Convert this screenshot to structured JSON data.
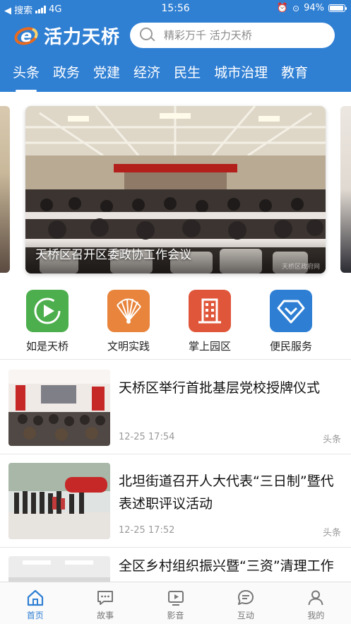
{
  "status_bar": {
    "back_label": "◀ 搜索",
    "network": "4G",
    "time": "15:56",
    "battery": "94%"
  },
  "header": {
    "app_name": "活力天桥",
    "search_placeholder": "精彩万千 活力天桥",
    "accent_color": "#2f7fd3"
  },
  "tabs": [
    {
      "label": "头条",
      "active": true
    },
    {
      "label": "政务"
    },
    {
      "label": "党建"
    },
    {
      "label": "经济"
    },
    {
      "label": "民生"
    },
    {
      "label": "城市治理"
    },
    {
      "label": "教育"
    }
  ],
  "carousel": {
    "caption": "天桥区召开区委政协工作会议",
    "watermark": "天桥区政府网"
  },
  "quick_entries": [
    {
      "label": "如是天桥",
      "color": "#4cae4c",
      "icon": "play-icon"
    },
    {
      "label": "文明实践",
      "color": "#e8843c",
      "icon": "fan-icon"
    },
    {
      "label": "掌上园区",
      "color": "#e0563a",
      "icon": "building-icon"
    },
    {
      "label": "便民服务",
      "color": "#2e7fd4",
      "icon": "diamond-icon"
    }
  ],
  "news": [
    {
      "title": "天桥区举行首批基层党校授牌仪式",
      "time": "12-25 17:54",
      "tag": "头条"
    },
    {
      "title": "北坦街道召开人大代表“三日制”暨代表述职评议活动",
      "time": "12-25 17:52",
      "tag": "头条"
    },
    {
      "title": "全区乡村组织振兴暨“三资”清理工作推进会在桑梓店街道",
      "time": "",
      "tag": ""
    }
  ],
  "bottom_nav": [
    {
      "label": "首页",
      "icon": "home-icon",
      "active": true
    },
    {
      "label": "故事",
      "icon": "chat-icon"
    },
    {
      "label": "影音",
      "icon": "video-icon"
    },
    {
      "label": "互动",
      "icon": "message-icon"
    },
    {
      "label": "我的",
      "icon": "user-icon"
    }
  ]
}
